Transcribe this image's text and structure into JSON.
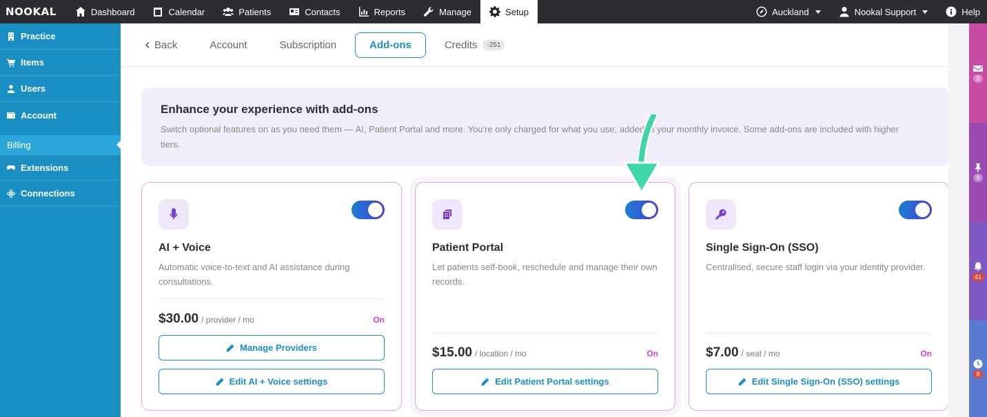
{
  "app": {
    "logo": "NOOKAL"
  },
  "topnav": {
    "items": [
      {
        "label": "Dashboard",
        "icon": "home-icon"
      },
      {
        "label": "Calendar",
        "icon": "calendar-icon"
      },
      {
        "label": "Patients",
        "icon": "users-icon"
      },
      {
        "label": "Contacts",
        "icon": "address-card-icon"
      },
      {
        "label": "Reports",
        "icon": "chart-icon"
      },
      {
        "label": "Manage",
        "icon": "wrench-icon"
      },
      {
        "label": "Setup",
        "icon": "gear-icon",
        "active": true
      }
    ],
    "location": "Auckland",
    "user": "Nookal Support",
    "help": "Help"
  },
  "sidebar": {
    "items": [
      {
        "label": "Practice",
        "icon": "building-icon"
      },
      {
        "label": "Items",
        "icon": "cart-icon"
      },
      {
        "label": "Users",
        "icon": "user-icon"
      },
      {
        "label": "Account",
        "icon": "wallet-icon"
      },
      {
        "label": "Billing",
        "sub": true
      },
      {
        "label": "Extensions",
        "icon": "gamepad-icon"
      },
      {
        "label": "Connections",
        "icon": "atom-icon"
      }
    ]
  },
  "tabs": {
    "back": "Back",
    "account": "Account",
    "subscription": "Subscription",
    "addons": "Add-ons",
    "credits": "Credits",
    "credits_badge": "-251"
  },
  "banner": {
    "title": "Enhance your experience with add-ons",
    "text": "Switch optional features on as you need them — AI, Patient Portal and more. You're only charged for what you use, added to your monthly invoice. Some add-ons are included with higher tiers."
  },
  "cards": [
    {
      "title": "AI + Voice",
      "icon": "microphone-icon",
      "desc": "Automatic voice-to-text and AI assistance during consultations.",
      "price": "$30.00",
      "unit": "/ provider / mo",
      "status": "On",
      "enabled": true,
      "button1": "Manage Providers",
      "button2": "Edit AI + Voice settings"
    },
    {
      "title": "Patient Portal",
      "icon": "portal-icon",
      "desc": "Let patients self-book, reschedule and manage their own records.",
      "price": "$15.00",
      "unit": "/ location / mo",
      "status": "On",
      "enabled": true,
      "button2": "Edit Patient Portal settings"
    },
    {
      "title": "Single Sign-On (SSO)",
      "icon": "key-icon",
      "desc": "Centralised, secure staff login via your identity provider.",
      "price": "$7.00",
      "unit": "/ seat / mo",
      "status": "On",
      "enabled": true,
      "button2": "Edit Single Sign-On (SSO) settings"
    }
  ],
  "rail": {
    "messages": "0",
    "pins": "0",
    "notifications": "41",
    "history": "8"
  },
  "colors": {
    "topbar": "#2b2d31",
    "sidebar": "#1a8fc4",
    "accent": "#1a8fc4",
    "status_on": "#d23fc5",
    "arrow": "#3fd6a8"
  }
}
